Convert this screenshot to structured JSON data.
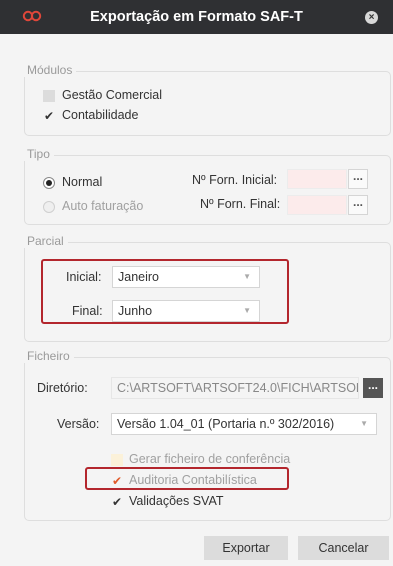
{
  "window": {
    "title": "Exportação em Formato SAF-T",
    "close_symbol": "×"
  },
  "modulos": {
    "legend": "Módulos",
    "items": [
      {
        "label": "Gestão Comercial",
        "checked": false
      },
      {
        "label": "Contabilidade",
        "checked": true
      }
    ]
  },
  "tipo": {
    "legend": "Tipo",
    "normal_label": "Normal",
    "auto_label": "Auto faturação",
    "forn_inicial_label": "Nº Forn. Inicial:",
    "forn_final_label": "Nº Forn. Final:",
    "forn_inicial_value": "",
    "forn_final_value": ""
  },
  "parcial": {
    "legend": "Parcial",
    "inicial_label": "Inicial:",
    "inicial_value": "Janeiro",
    "final_label": "Final:",
    "final_value": "Junho"
  },
  "ficheiro": {
    "legend": "Ficheiro",
    "diretorio_label": "Diretório:",
    "diretorio_value": "C:\\ARTSOFT\\ARTSOFT24.0\\FICH\\ARTSOF",
    "versao_label": "Versão:",
    "versao_value": "Versão 1.04_01 (Portaria n.º 302/2016)",
    "gerar_label": "Gerar ficheiro de conferência",
    "auditoria_label": "Auditoria Contabilística",
    "validacoes_label": "Validações SVAT"
  },
  "buttons": {
    "exportar": "Exportar",
    "cancelar": "Cancelar"
  },
  "ellipsis": "...",
  "colors": {
    "highlight": "#b3262d",
    "check_orange": "#e05a2a",
    "titlebar": "#2f3033"
  }
}
